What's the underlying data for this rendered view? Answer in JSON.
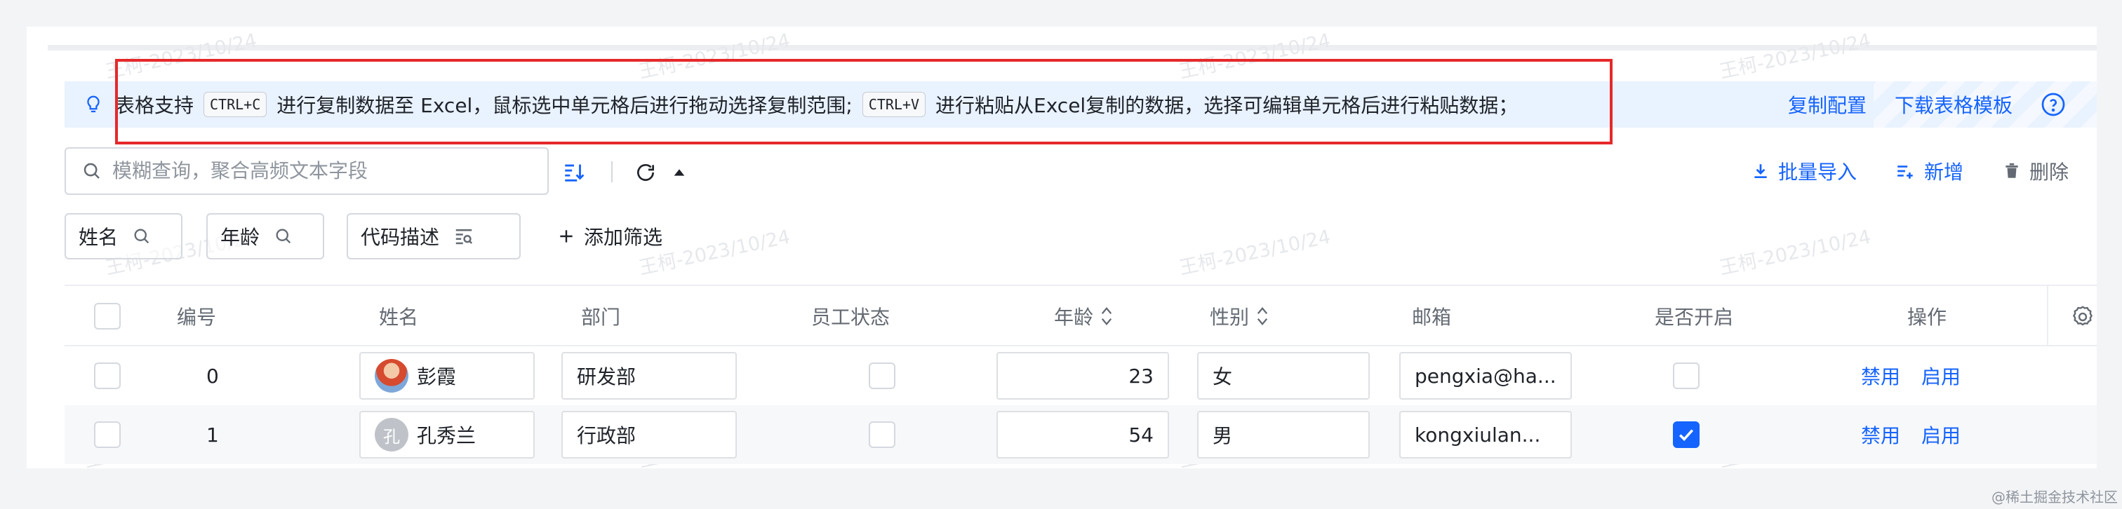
{
  "banner": {
    "segment1": "表格支持",
    "key_copy": "CTRL+C",
    "segment2": "进行复制数据至 Excel，鼠标选中单元格后进行拖动选择复制范围;",
    "key_paste": "CTRL+V",
    "segment3": "进行粘贴从Excel复制的数据，选择可编辑单元格后进行粘贴数据；",
    "copy_config": "复制配置",
    "download_template": "下载表格模板"
  },
  "search": {
    "placeholder": "模糊查询，聚合高频文本字段"
  },
  "actions": {
    "bulk_import": "批量导入",
    "add": "新增",
    "delete": "删除"
  },
  "filters": [
    {
      "label": "姓名"
    },
    {
      "label": "年龄"
    },
    {
      "label": "代码描述"
    }
  ],
  "add_filter": "添加筛选",
  "table": {
    "columns": [
      "编号",
      "姓名",
      "部门",
      "员工状态",
      "年龄",
      "性别",
      "邮箱",
      "是否开启",
      "操作"
    ],
    "rows": [
      {
        "id": "0",
        "name": "彭霞",
        "avatar_char": "",
        "dept": "研发部",
        "age": "23",
        "gender": "女",
        "email": "pengxia@ha...",
        "enabled": false,
        "op1": "禁用",
        "op2": "启用"
      },
      {
        "id": "1",
        "name": "孔秀兰",
        "avatar_char": "孔",
        "dept": "行政部",
        "age": "54",
        "gender": "男",
        "email": "kongxiulan...",
        "enabled": true,
        "op1": "禁用",
        "op2": "启用"
      }
    ]
  },
  "watermark": "王柯-2023/10/24",
  "site_mark": "@稀土掘金技术社区",
  "colors": {
    "primary": "#1664ff",
    "banner_bg": "#e9f2ff",
    "highlight": "#e5292a"
  }
}
